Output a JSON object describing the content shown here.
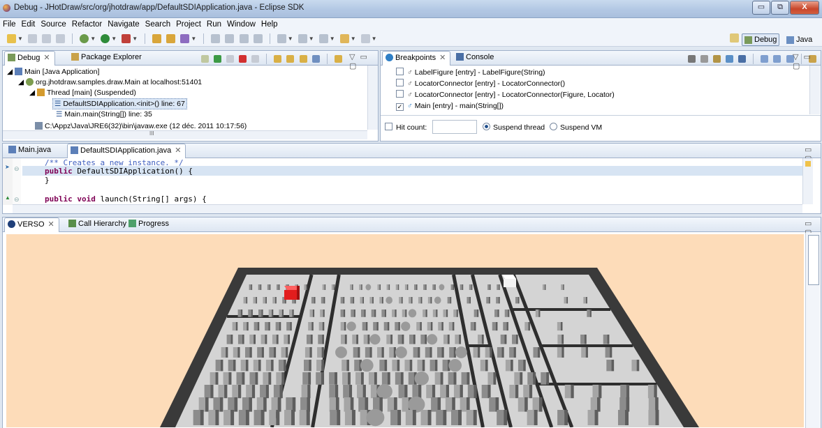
{
  "window": {
    "title": "Debug - JHotDraw/src/org/jhotdraw/app/DefaultSDIApplication.java - Eclipse SDK",
    "minimize_glyph": "▭",
    "maximize_glyph": "⧉",
    "close_glyph": "X"
  },
  "menu": [
    "File",
    "Edit",
    "Source",
    "Refactor",
    "Navigate",
    "Search",
    "Project",
    "Run",
    "Window",
    "Help"
  ],
  "perspectives": {
    "debug": "Debug",
    "java": "Java"
  },
  "debug_view": {
    "tabs": {
      "debug": "Debug",
      "package_explorer": "Package Explorer"
    },
    "tree": [
      "Main [Java Application]",
      "org.jhotdraw.samples.draw.Main at localhost:51401",
      "Thread [main] (Suspended)",
      "DefaultSDIApplication.<init>() line: 67",
      "Main.main(String[]) line: 35",
      "C:\\Appz\\Java\\JRE6(32)\\bin\\javaw.exe (12 déc. 2011 10:17:56)"
    ],
    "hscroll_grip": "III"
  },
  "breakpoints_view": {
    "tabs": {
      "breakpoints": "Breakpoints",
      "console": "Console"
    },
    "items": [
      {
        "label": "LabelFigure [entry] - LabelFigure(String)",
        "checked": false
      },
      {
        "label": "LocatorConnector [entry] - LocatorConnector()",
        "checked": false
      },
      {
        "label": "LocatorConnector [entry] - LocatorConnector(Figure, Locator)",
        "checked": false
      },
      {
        "label": "Main [entry] - main(String[])",
        "checked": true
      }
    ],
    "hit_count_label": "Hit count:",
    "suspend_thread_label": "Suspend thread",
    "suspend_vm_label": "Suspend VM"
  },
  "editor": {
    "tabs": {
      "main": "Main.java",
      "default_sdi": "DefaultSDIApplication.java"
    },
    "lines": [
      {
        "comment": "/** Creates a new instance. */"
      },
      {
        "kw": "public",
        "rest": " DefaultSDIApplication() {"
      },
      {
        "rest": "}"
      },
      {
        "rest": ""
      },
      {
        "kw": "public void",
        "rest": " launch(String[] args) {"
      }
    ]
  },
  "bottom_view": {
    "tabs": {
      "verso": "VERSO",
      "call_hierarchy": "Call Hierarchy",
      "progress": "Progress"
    }
  },
  "colors": {
    "canvas_bg": "#fddcb9",
    "selected_block": "#e21d1d",
    "accent": "#4a6fa5"
  },
  "icons": [
    "debug-icon",
    "package-icon",
    "breakpoint-icon",
    "console-icon",
    "java-file-icon",
    "verso-icon",
    "call-hierarchy-icon",
    "progress-icon"
  ]
}
